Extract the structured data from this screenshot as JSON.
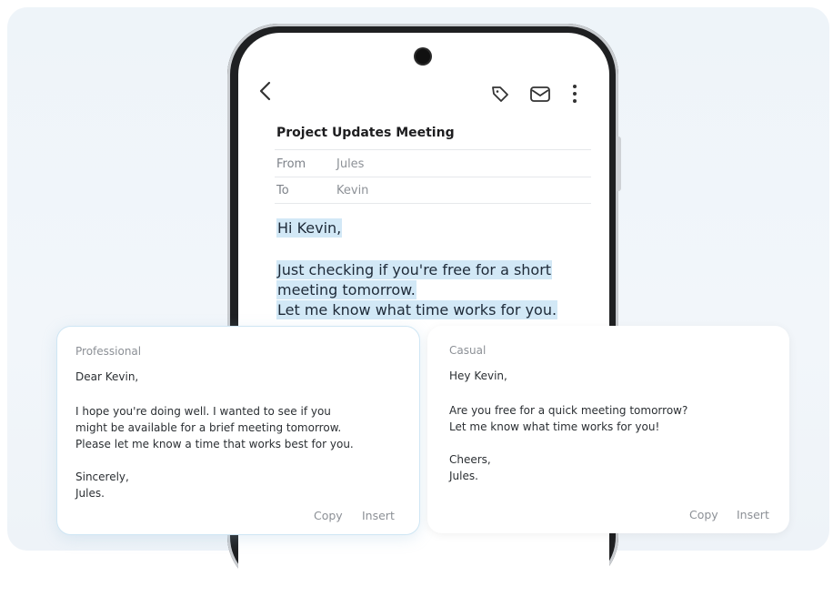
{
  "email": {
    "subject": "Project Updates Meeting",
    "from_label": "From",
    "from_value": "Jules",
    "to_label": "To",
    "to_value": "Kevin",
    "greeting": "Hi Kevin,",
    "body_lines": [
      "Just checking if you're free for a short",
      "meeting tomorrow.",
      "Let me know what time works for you."
    ]
  },
  "toolbar": {
    "icons": [
      "back-icon",
      "tag-icon",
      "mail-icon",
      "more-vert-icon"
    ]
  },
  "suggestions": [
    {
      "tone": "Professional",
      "greeting": "Dear Kevin,",
      "lines": [
        "I hope you're doing well. I wanted to see if you",
        "might be available for a brief meeting tomorrow.",
        "Please let me know a time that works best for you."
      ],
      "signoff": "Sincerely,",
      "name": "Jules.",
      "copy_label": "Copy",
      "insert_label": "Insert"
    },
    {
      "tone": "Casual",
      "greeting": "Hey Kevin,",
      "lines": [
        "Are you free for a quick meeting tomorrow?",
        "Let me know what time works for you!"
      ],
      "signoff": "Cheers,",
      "name": "Jules.",
      "copy_label": "Copy",
      "insert_label": "Insert"
    }
  ],
  "colors": {
    "highlight": "#d2e8f6",
    "accent_border": "#cfe6f4",
    "phone_frame": "#1f2022"
  }
}
